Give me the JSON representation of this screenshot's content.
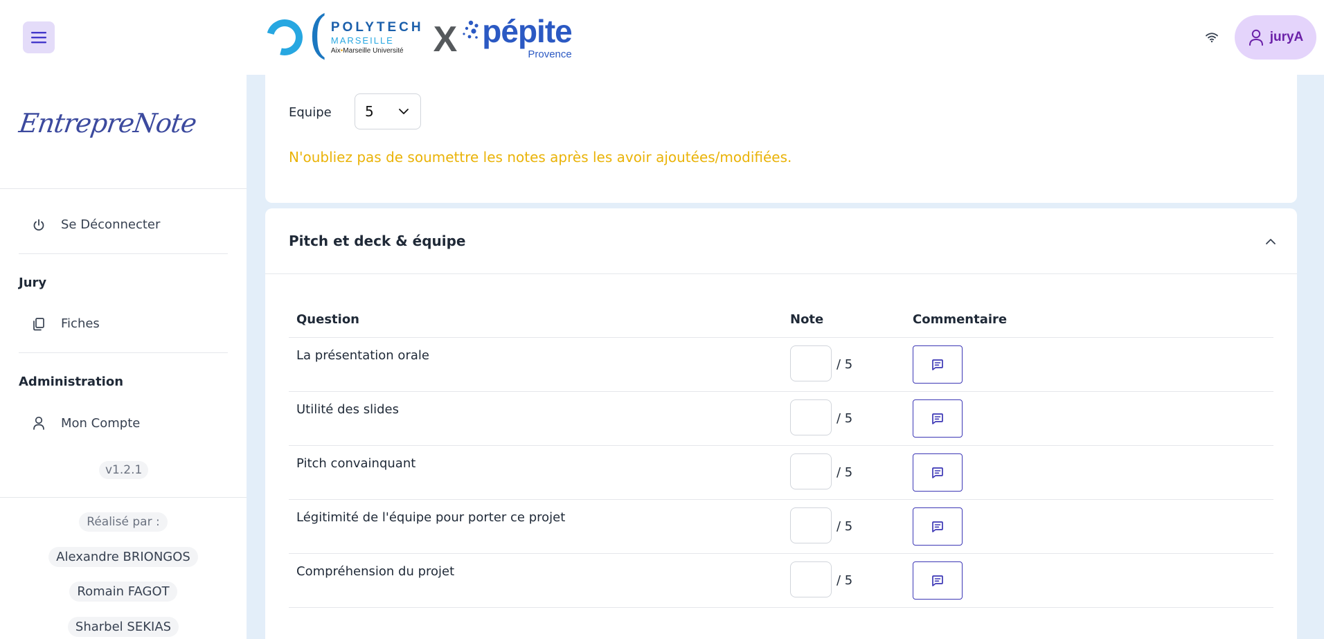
{
  "header": {
    "logo_polytech_title": "POLYTECH",
    "logo_polytech_city": "MARSEILLE",
    "logo_polytech_university_a": "Aix",
    "logo_polytech_university_b": "Marseille Université",
    "logo_separator": "X",
    "logo_pepite": "pépite",
    "logo_pepite_region": "Provence",
    "user_name": "juryA"
  },
  "sidebar": {
    "brand": "EntrepreNote",
    "logout_label": "Se Déconnecter",
    "section_jury": "Jury",
    "item_fiches": "Fiches",
    "section_admin": "Administration",
    "item_account": "Mon Compte",
    "version": "v1.2.1",
    "credits_label": "Réalisé par :",
    "credits": [
      "Alexandre BRIONGOS",
      "Romain FAGOT",
      "Sharbel SEKIAS"
    ]
  },
  "main": {
    "equipe_label": "Equipe",
    "equipe_value": "5",
    "warning": "N'oubliez pas de soumettre les notes après les avoir ajoutées/modifiées.",
    "section_title": "Pitch et deck & équipe",
    "columns": [
      "Question",
      "Note",
      "Commentaire"
    ],
    "rows": [
      {
        "question": "La présentation orale",
        "max": "/ 5"
      },
      {
        "question": "Utilité des slides",
        "max": "/ 5"
      },
      {
        "question": "Pitch convainquant",
        "max": "/ 5"
      },
      {
        "question": "Légitimité de l'équipe pour porter ce projet",
        "max": "/ 5"
      },
      {
        "question": "Compréhension du projet",
        "max": "/ 5"
      }
    ]
  },
  "colors": {
    "accent": "#3b36b5",
    "warning": "#eab308",
    "background": "#e3eef9",
    "user_pill": "#e4d4fb"
  },
  "icons": [
    "menu-icon",
    "wifi-icon",
    "user-icon",
    "power-icon",
    "documents-icon",
    "user-outline-icon",
    "chevron-down-icon",
    "chevron-up-icon",
    "comment-icon"
  ]
}
